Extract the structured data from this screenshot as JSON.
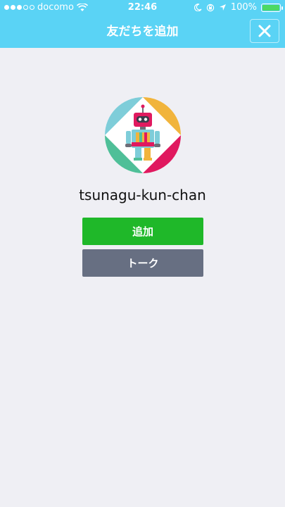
{
  "status_bar": {
    "carrier": "docomo",
    "time": "22:46",
    "battery_percent": "100%"
  },
  "header": {
    "title": "友だちを追加",
    "close_icon": "close-icon"
  },
  "profile": {
    "name": "tsunagu-kun-chan",
    "avatar_icon": "robot-avatar"
  },
  "actions": {
    "add_label": "追加",
    "talk_label": "トーク"
  },
  "colors": {
    "header_bg": "#5ad3f5",
    "add_button": "#1fb829",
    "talk_button": "#676f82",
    "page_bg": "#efeff4"
  }
}
